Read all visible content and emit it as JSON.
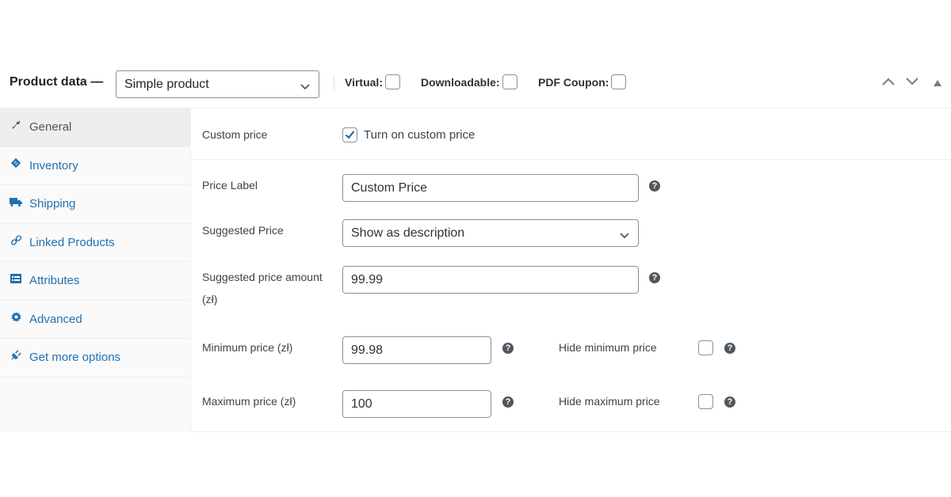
{
  "header": {
    "title": "Product data —",
    "product_type": "Simple product",
    "options": [
      {
        "label": "Virtual:",
        "checked": false
      },
      {
        "label": "Downloadable:",
        "checked": false
      },
      {
        "label": "PDF Coupon:",
        "checked": false
      }
    ],
    "icons": [
      "chevron-up-icon",
      "chevron-down-icon",
      "triangle-up-icon"
    ]
  },
  "sidebar": {
    "items": [
      {
        "label": "General",
        "icon": "wrench-icon",
        "active": true
      },
      {
        "label": "Inventory",
        "icon": "tag-icon",
        "active": false
      },
      {
        "label": "Shipping",
        "icon": "truck-icon",
        "active": false
      },
      {
        "label": "Linked Products",
        "icon": "link-icon",
        "active": false
      },
      {
        "label": "Attributes",
        "icon": "list-icon",
        "active": false
      },
      {
        "label": "Advanced",
        "icon": "gear-icon",
        "active": false
      },
      {
        "label": "Get more options",
        "icon": "plug-icon",
        "active": false
      }
    ]
  },
  "general": {
    "custom_price": {
      "label": "Custom price",
      "checkbox_label": "Turn on custom price",
      "checked": true
    },
    "price_label": {
      "label": "Price Label",
      "value": "Custom Price"
    },
    "suggested_price": {
      "label": "Suggested Price",
      "value": "Show as description"
    },
    "suggested_amount": {
      "label_line1": "Suggested price amount",
      "label_line2": "(zł)",
      "value": "99.99"
    },
    "minimum_price": {
      "label": "Minimum price (zł)",
      "value": "99.98",
      "hide_label": "Hide minimum price",
      "hide_checked": false
    },
    "maximum_price": {
      "label": "Maximum price (zł)",
      "value": "100",
      "hide_label": "Hide maximum price",
      "hide_checked": false
    },
    "help_glyph": "?"
  },
  "colors": {
    "link": "#2271b1",
    "active_tab_bg": "#eeeeee",
    "sidebar_bg": "#fafafa",
    "check_accent": "#2271b1"
  }
}
